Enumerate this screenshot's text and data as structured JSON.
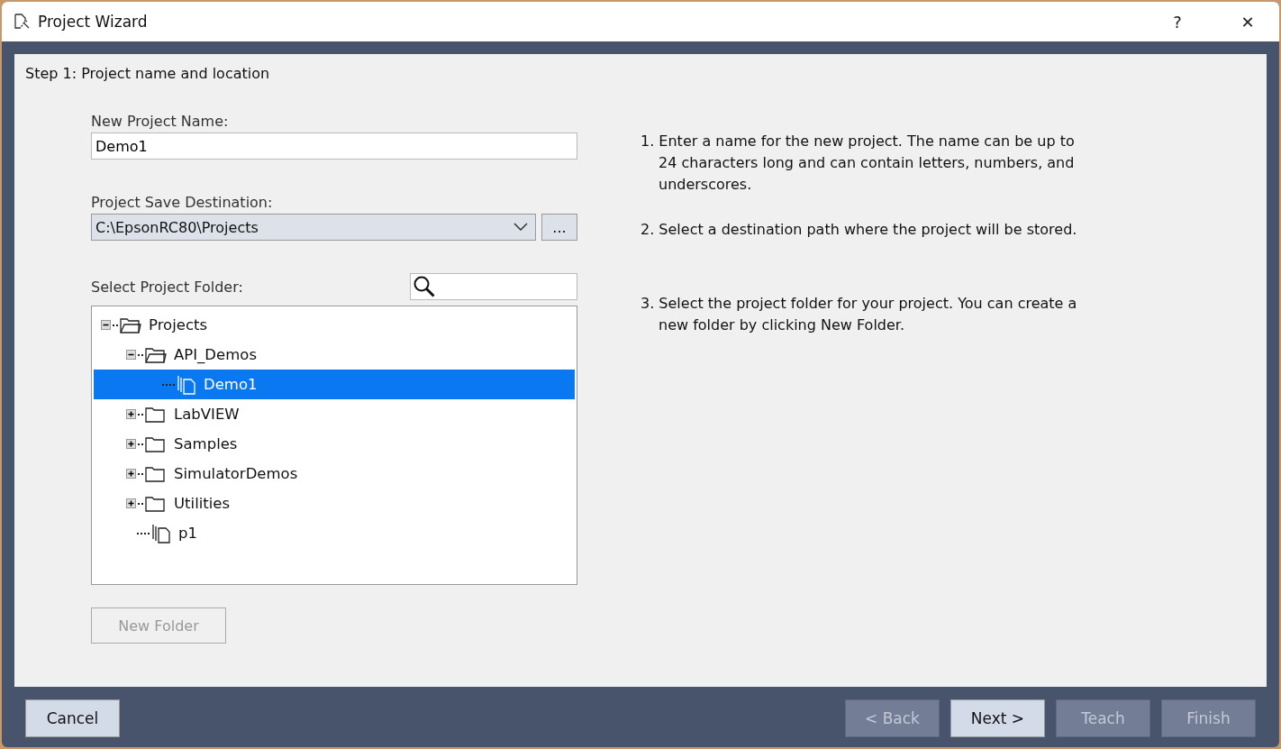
{
  "window": {
    "title": "Project Wizard",
    "help": "?",
    "close": "✕"
  },
  "step_title": "Step 1: Project name and location",
  "name_field": {
    "label": "New Project Name:",
    "value": "Demo1"
  },
  "destination": {
    "label": "Project Save Destination:",
    "value": "C:\\EpsonRC80\\Projects",
    "browse": "..."
  },
  "folder": {
    "label": "Select Project Folder:"
  },
  "tree": [
    {
      "label": "Projects",
      "kind": "folder",
      "expanded": true,
      "selected": false,
      "children": [
        {
          "label": "API_Demos",
          "kind": "folder",
          "expanded": true,
          "selected": false,
          "children": [
            {
              "label": "Demo1",
              "kind": "project",
              "selected": true
            }
          ]
        },
        {
          "label": "LabVIEW",
          "kind": "folder",
          "expanded": false,
          "selected": false
        },
        {
          "label": "Samples",
          "kind": "folder",
          "expanded": false,
          "selected": false
        },
        {
          "label": "SimulatorDemos",
          "kind": "folder",
          "expanded": false,
          "selected": false
        },
        {
          "label": "Utilities",
          "kind": "folder",
          "expanded": false,
          "selected": false
        },
        {
          "label": "p1",
          "kind": "project",
          "selected": false
        }
      ]
    }
  ],
  "new_folder": {
    "label": "New Folder",
    "disabled": true
  },
  "instructions": [
    "1. Enter a name for the new project.  The name can be up to 24 characters long and can contain letters, numbers, and underscores.",
    "2. Select a destination path where the project will be stored.",
    "3. Select the project folder for your project.  You can create a new folder by clicking New Folder."
  ],
  "footer": [
    {
      "label": "Cancel",
      "disabled": false
    },
    {
      "label": "< Back",
      "disabled": true
    },
    {
      "label": "Next >",
      "disabled": false
    },
    {
      "label": "Teach",
      "disabled": true
    },
    {
      "label": "Finish",
      "disabled": true
    }
  ]
}
